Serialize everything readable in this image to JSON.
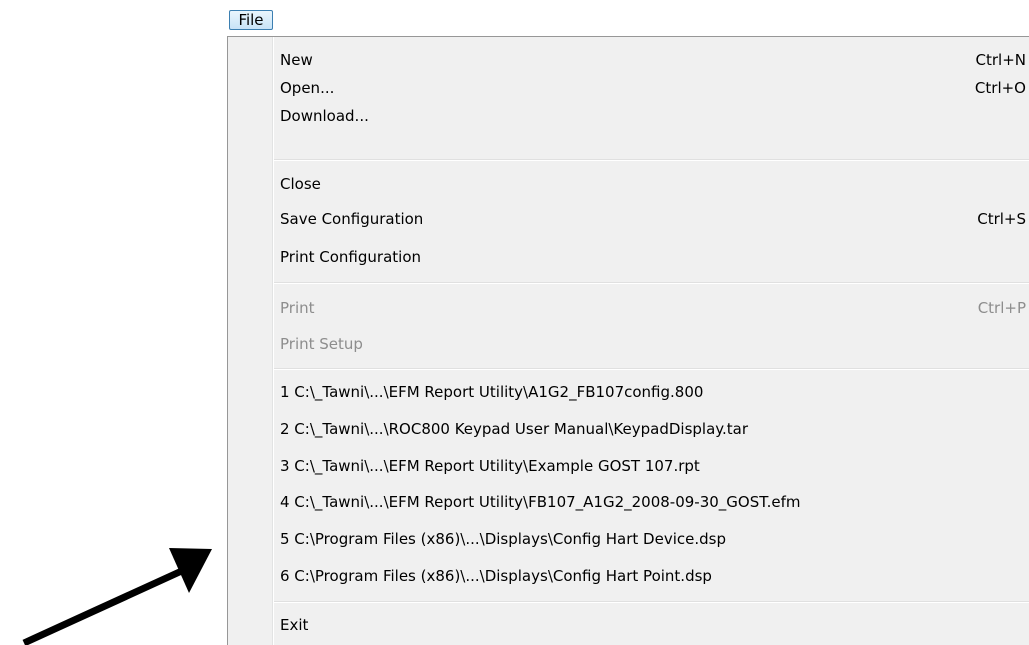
{
  "menubar": {
    "title": "File"
  },
  "menu": {
    "items": [
      {
        "label": "New",
        "shortcut": "Ctrl+N",
        "enabled": true
      },
      {
        "label": "Open...",
        "shortcut": "Ctrl+O",
        "enabled": true
      },
      {
        "label": "Download...",
        "shortcut": "",
        "enabled": true
      },
      {
        "label": "Close",
        "shortcut": "",
        "enabled": true
      },
      {
        "label": "Save Configuration",
        "shortcut": "Ctrl+S",
        "enabled": true
      },
      {
        "label": "Print Configuration",
        "shortcut": "",
        "enabled": true
      },
      {
        "label": "Print",
        "shortcut": "Ctrl+P",
        "enabled": false
      },
      {
        "label": "Print Setup",
        "shortcut": "",
        "enabled": false
      },
      {
        "label": "1 C:\\_Tawni\\...\\EFM Report Utility\\A1G2_FB107config.800",
        "shortcut": "",
        "enabled": true
      },
      {
        "label": "2 C:\\_Tawni\\...\\ROC800 Keypad User Manual\\KeypadDisplay.tar",
        "shortcut": "",
        "enabled": true
      },
      {
        "label": "3 C:\\_Tawni\\...\\EFM Report Utility\\Example GOST 107.rpt",
        "shortcut": "",
        "enabled": true
      },
      {
        "label": "4 C:\\_Tawni\\...\\EFM Report Utility\\FB107_A1G2_2008-09-30_GOST.efm",
        "shortcut": "",
        "enabled": true
      },
      {
        "label": "5 C:\\Program Files (x86)\\...\\Displays\\Config Hart Device.dsp",
        "shortcut": "",
        "enabled": true
      },
      {
        "label": "6 C:\\Program Files (x86)\\...\\Displays\\Config Hart Point.dsp",
        "shortcut": "",
        "enabled": true
      },
      {
        "label": "Exit",
        "shortcut": "",
        "enabled": true
      }
    ]
  },
  "colors": {
    "menu_background": "#f0f0f0",
    "disabled_text": "#8d8d8d",
    "highlight_border": "#3c7fb1",
    "annotation_arrow": "#000000"
  }
}
